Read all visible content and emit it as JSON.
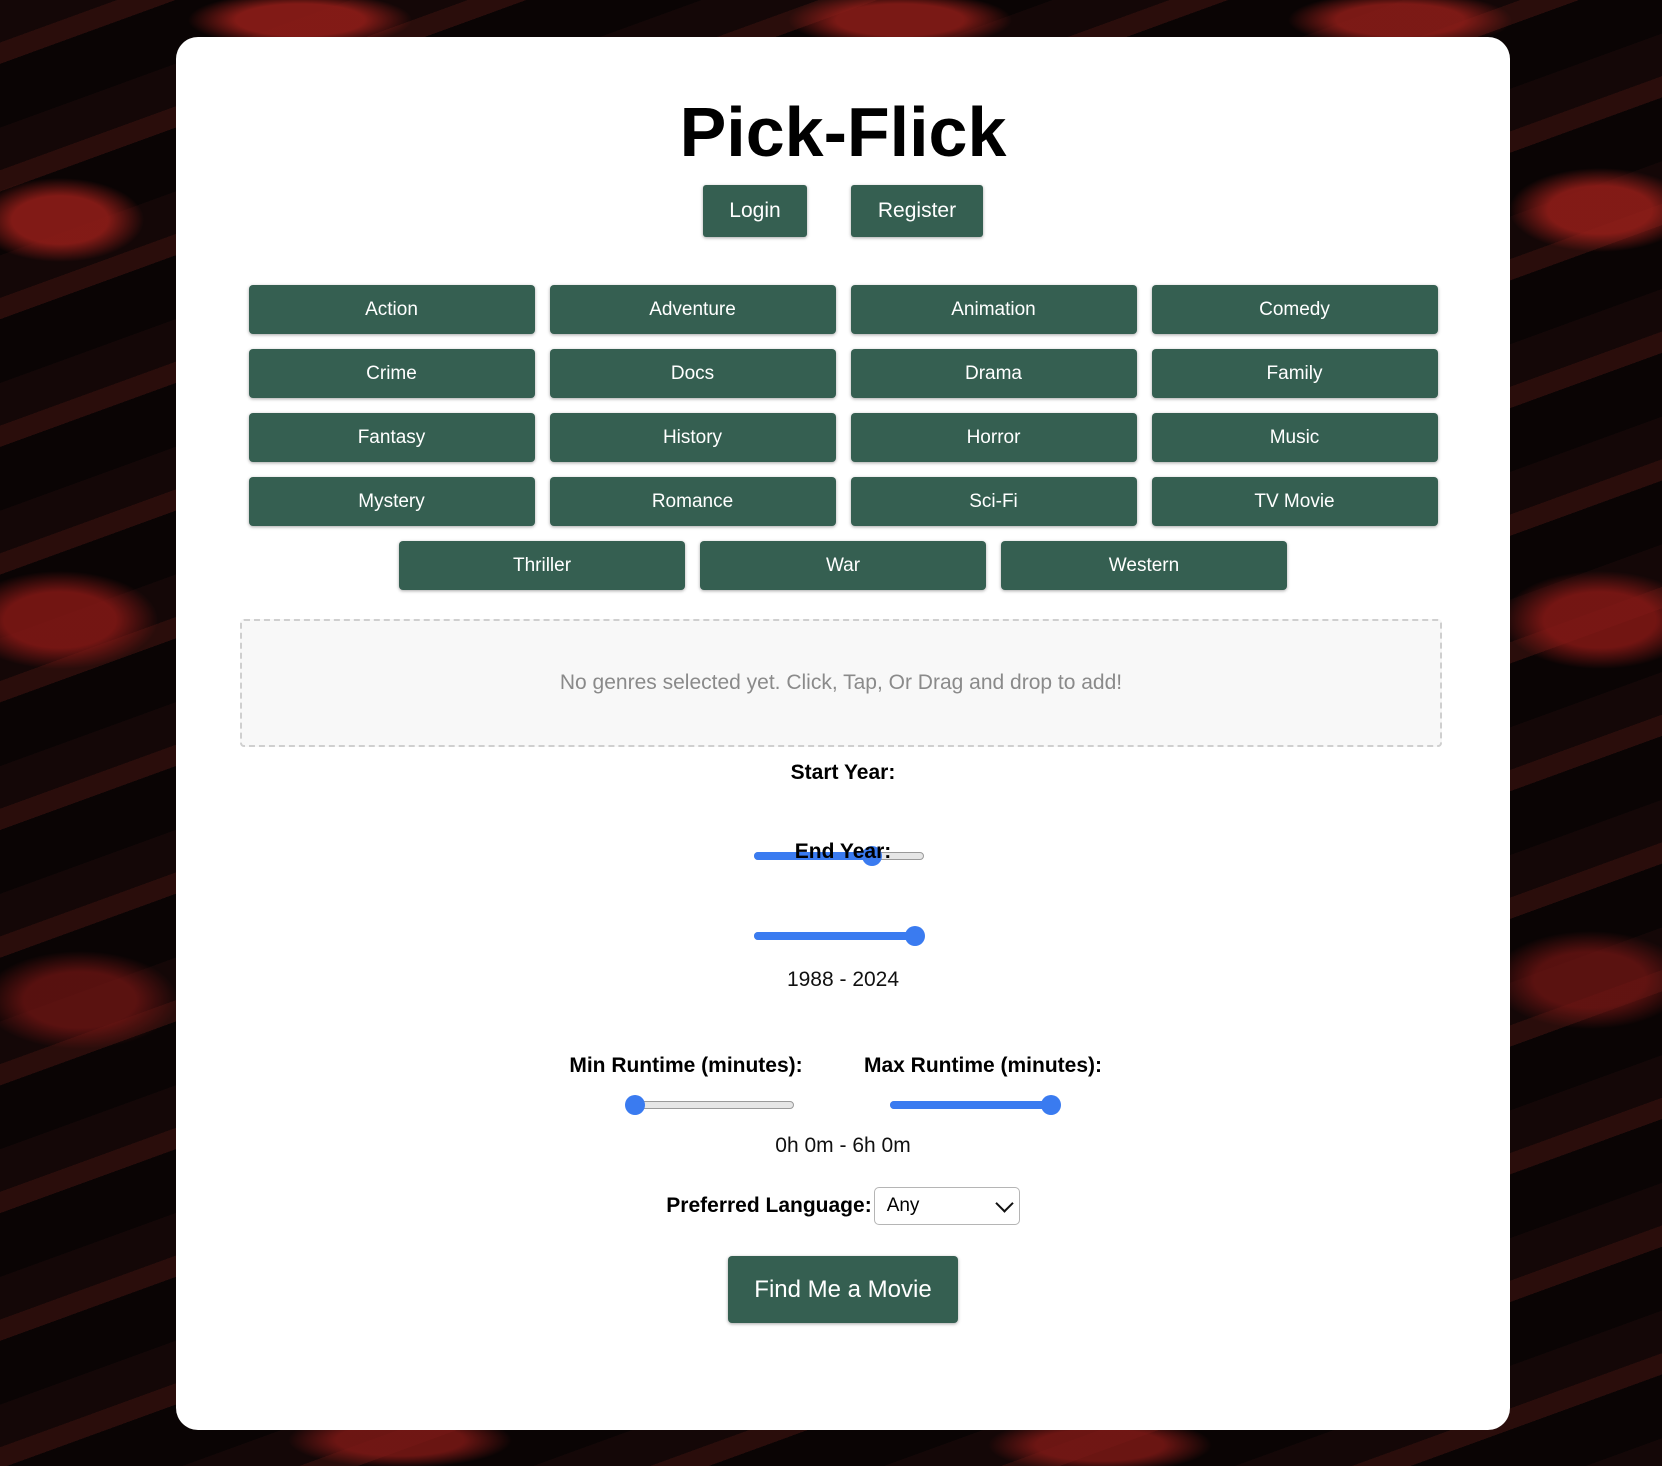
{
  "app": {
    "title": "Pick-Flick"
  },
  "auth": {
    "login_label": "Login",
    "register_label": "Register"
  },
  "genres": {
    "rows": [
      [
        "Action",
        "Adventure",
        "Animation",
        "Comedy"
      ],
      [
        "Crime",
        "Docs",
        "Drama",
        "Family"
      ],
      [
        "Fantasy",
        "History",
        "Horror",
        "Music"
      ],
      [
        "Mystery",
        "Romance",
        "Sci-Fi",
        "TV Movie"
      ],
      [
        "Thriller",
        "War",
        "Western"
      ]
    ]
  },
  "dropzone": {
    "empty_text": "No genres selected yet. Click, Tap, Or Drag and drop to add!"
  },
  "years": {
    "start_label": "Start Year:",
    "end_label": "End Year:",
    "start_fraction": 0.69,
    "end_fraction": 1.0,
    "range_text": "1988 - 2024"
  },
  "runtime": {
    "min_label": "Min Runtime (minutes):",
    "max_label": "Max Runtime (minutes):",
    "min_fraction": 0.0,
    "max_fraction": 1.0,
    "range_text": "0h 0m - 6h 0m"
  },
  "language": {
    "label": "Preferred Language:",
    "selected": "Any"
  },
  "actions": {
    "find_label": "Find Me a Movie"
  },
  "colors": {
    "button_green": "#355f51",
    "slider_blue": "#3a7bf0"
  }
}
